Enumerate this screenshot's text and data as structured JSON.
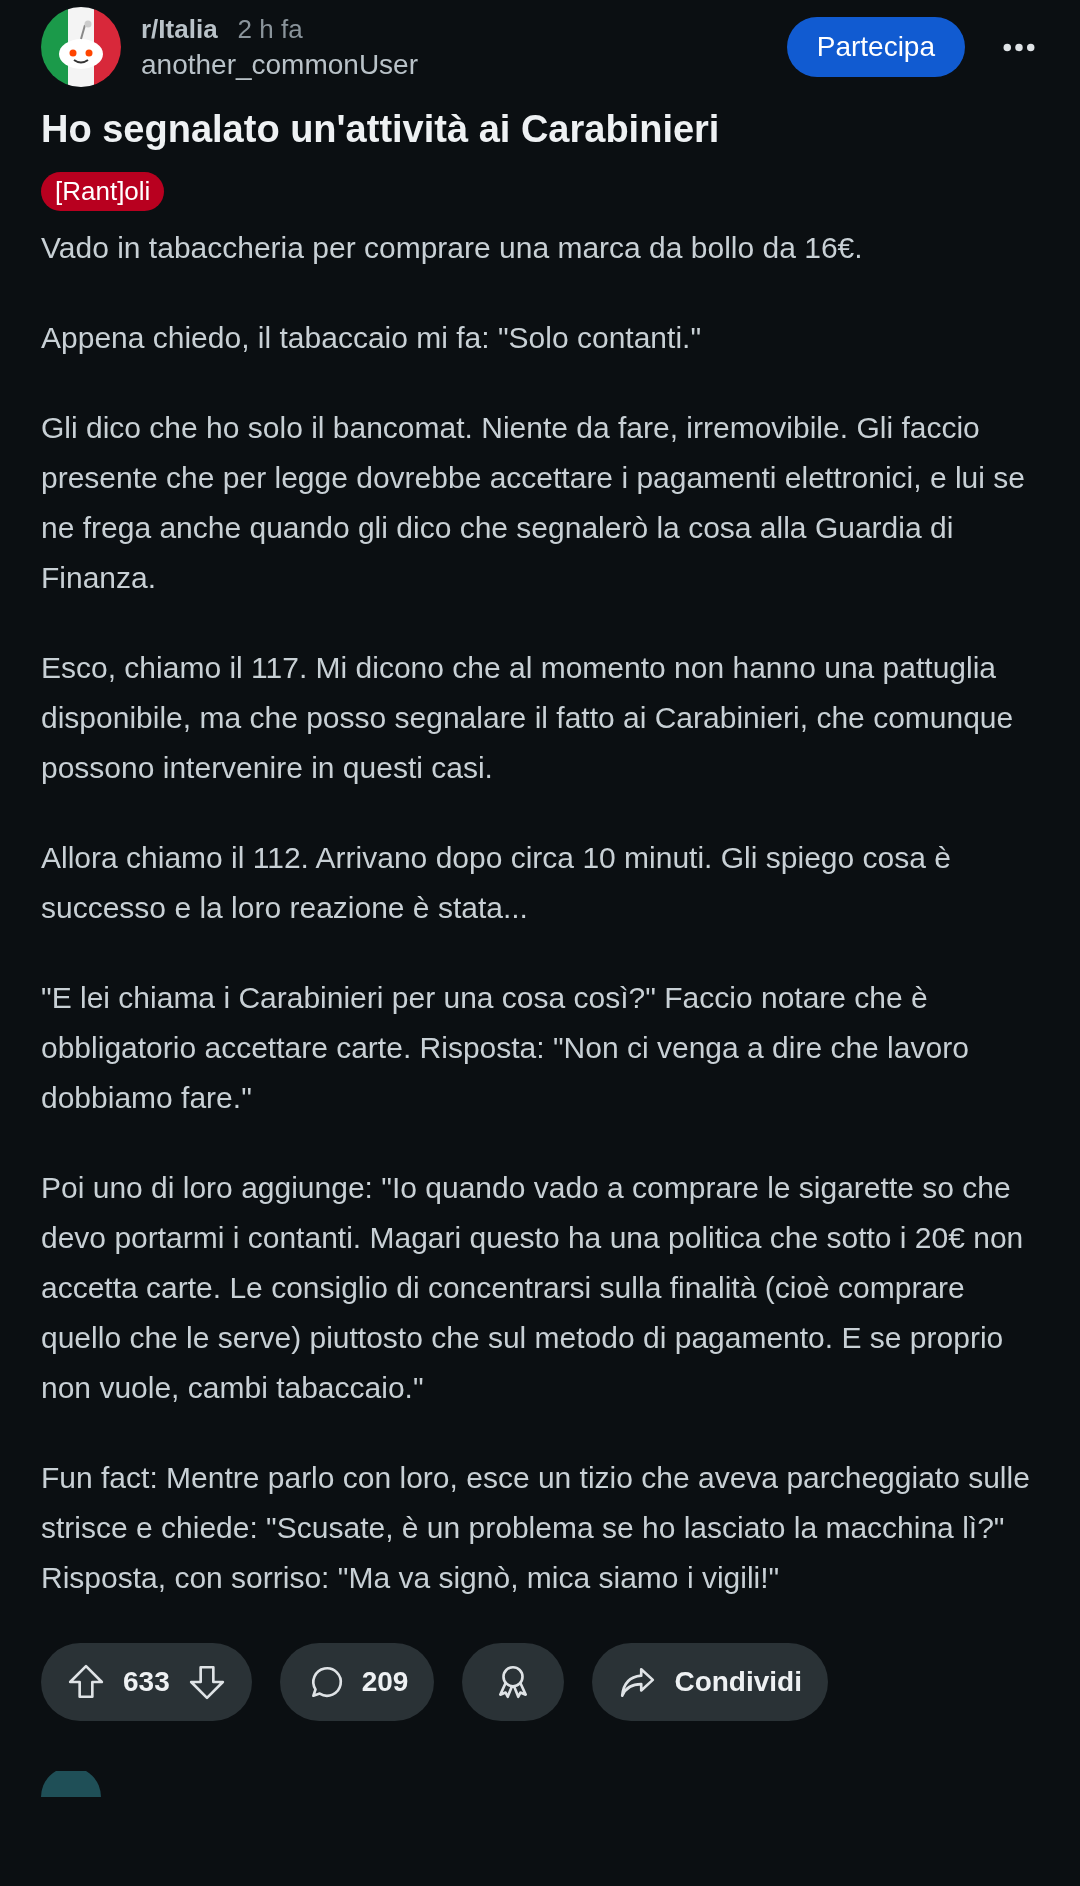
{
  "post": {
    "subreddit": "r/Italia",
    "time": "2 h fa",
    "author": "another_commonUser",
    "join_button": "Partecipa",
    "title": "Ho segnalato un'attività ai Carabinieri",
    "flair": {
      "text": "[Rant]oli",
      "color": "#b8001f"
    },
    "body": [
      "Vado in tabaccheria per comprare una marca da bollo da 16€.",
      "Appena chiedo, il tabaccaio mi fa: \"Solo contanti.\"",
      "Gli dico che ho solo il bancomat. Niente da fare, irremovibile. Gli faccio presente che per legge dovrebbe accettare i pagamenti elettronici, e lui se ne frega anche quando gli dico che segnalerò la cosa alla Guardia di Finanza.",
      "Esco, chiamo il 117. Mi dicono che al momento non hanno una pattuglia disponibile, ma che posso segnalare il fatto ai Carabinieri, che comunque possono intervenire in questi casi.",
      "Allora chiamo il 112. Arrivano dopo circa 10 minuti. Gli spiego cosa è successo e la loro reazione è stata...",
      "\"E lei chiama i Carabinieri per una cosa così?\" Faccio notare che è obbligatorio accettare carte. Risposta: \"Non ci venga a dire che lavoro dobbiamo fare.\"",
      "Poi uno di loro aggiunge: \"Io quando vado a comprare le sigarette so che devo portarmi i contanti. Magari questo ha una politica che sotto i 20€ non accetta carte. Le consiglio di concentrarsi sulla finalità (cioè comprare quello che le serve) piuttosto che sul metodo di pagamento. E se proprio non vuole, cambi tabaccaio.\"",
      "Fun fact: Mentre parlo con loro, esce un tizio che aveva parcheggiato sulle strisce e chiede: \"Scusate, è un problema se ho lasciato la macchina lì?\" Risposta, con sorriso: \"Ma va signò, mica siamo i vigili!\""
    ],
    "actions": {
      "votes": "633",
      "comments": "209",
      "share": "Condividi"
    }
  }
}
